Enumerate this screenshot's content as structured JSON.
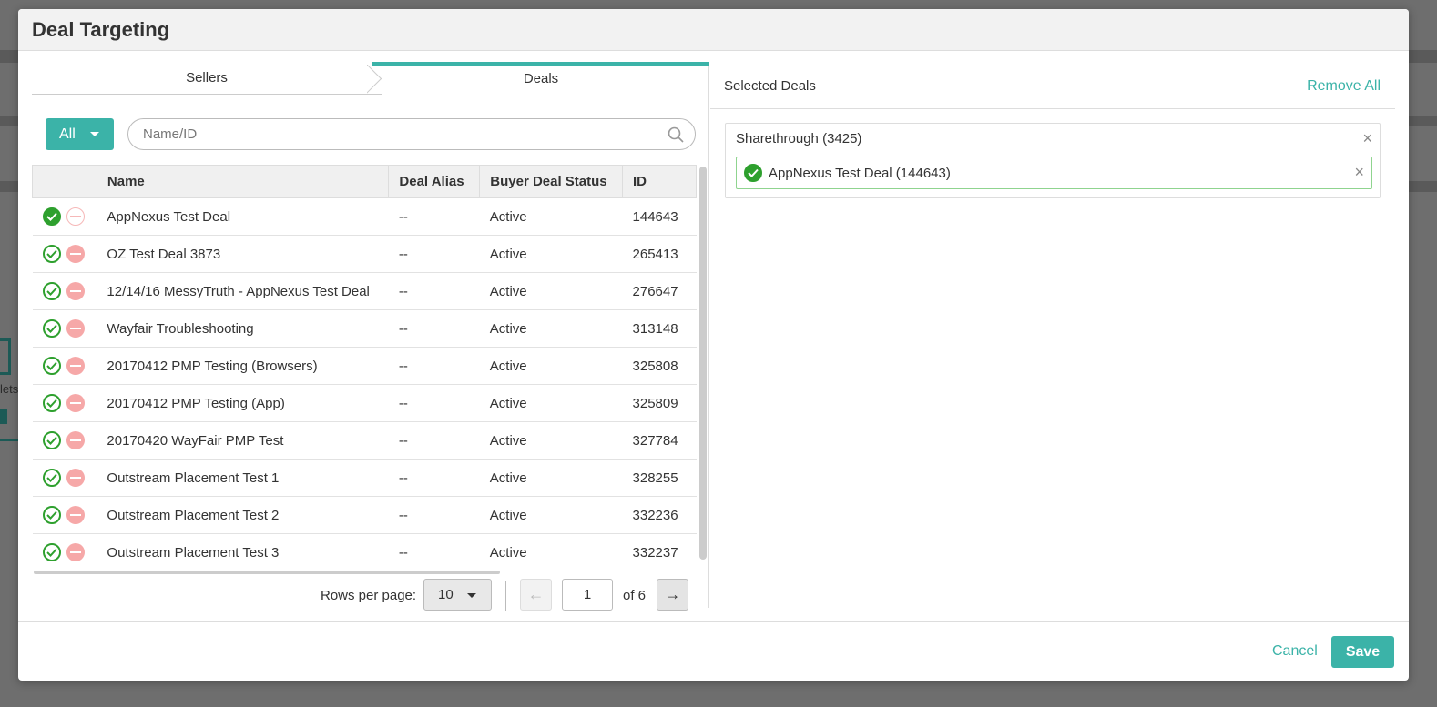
{
  "background": {
    "side_text": "lets"
  },
  "modal": {
    "title": "Deal Targeting"
  },
  "tabs": [
    {
      "label": "Sellers"
    },
    {
      "label": "Deals"
    }
  ],
  "filter": {
    "type_label": "All",
    "search_placeholder": "Name/ID"
  },
  "table": {
    "columns": [
      "Name",
      "Deal Alias",
      "Buyer Deal Status",
      "ID"
    ],
    "rows": [
      {
        "name": "AppNexus Test Deal",
        "alias": "--",
        "status": "Active",
        "id": "144643",
        "selected": true
      },
      {
        "name": "OZ Test Deal 3873",
        "alias": "--",
        "status": "Active",
        "id": "265413",
        "selected": false
      },
      {
        "name": "12/14/16 MessyTruth - AppNexus Test Deal",
        "alias": "--",
        "status": "Active",
        "id": "276647",
        "selected": false
      },
      {
        "name": "Wayfair Troubleshooting",
        "alias": "--",
        "status": "Active",
        "id": "313148",
        "selected": false
      },
      {
        "name": "20170412 PMP Testing (Browsers)",
        "alias": "--",
        "status": "Active",
        "id": "325808",
        "selected": false
      },
      {
        "name": "20170412 PMP Testing (App)",
        "alias": "--",
        "status": "Active",
        "id": "325809",
        "selected": false
      },
      {
        "name": "20170420 WayFair PMP Test",
        "alias": "--",
        "status": "Active",
        "id": "327784",
        "selected": false
      },
      {
        "name": "Outstream Placement Test 1",
        "alias": "--",
        "status": "Active",
        "id": "328255",
        "selected": false
      },
      {
        "name": "Outstream Placement Test 2",
        "alias": "--",
        "status": "Active",
        "id": "332236",
        "selected": false
      },
      {
        "name": "Outstream Placement Test 3",
        "alias": "--",
        "status": "Active",
        "id": "332237",
        "selected": false
      }
    ]
  },
  "pager": {
    "rows_label": "Rows per page:",
    "rows_value": "10",
    "prev_glyph": "←",
    "page_value": "1",
    "of_label": "of 6",
    "next_glyph": "→"
  },
  "selected": {
    "title": "Selected Deals",
    "remove_all": "Remove All",
    "seller_name": "Sharethrough (3425)",
    "deal_label": "AppNexus Test Deal (144643)",
    "remove_glyph": "×"
  },
  "footer": {
    "cancel": "Cancel",
    "save": "Save"
  },
  "colors": {
    "accent": "#3bb3a8",
    "include_green": "#2ea02e",
    "exclude_red": "#f6a8a8"
  }
}
